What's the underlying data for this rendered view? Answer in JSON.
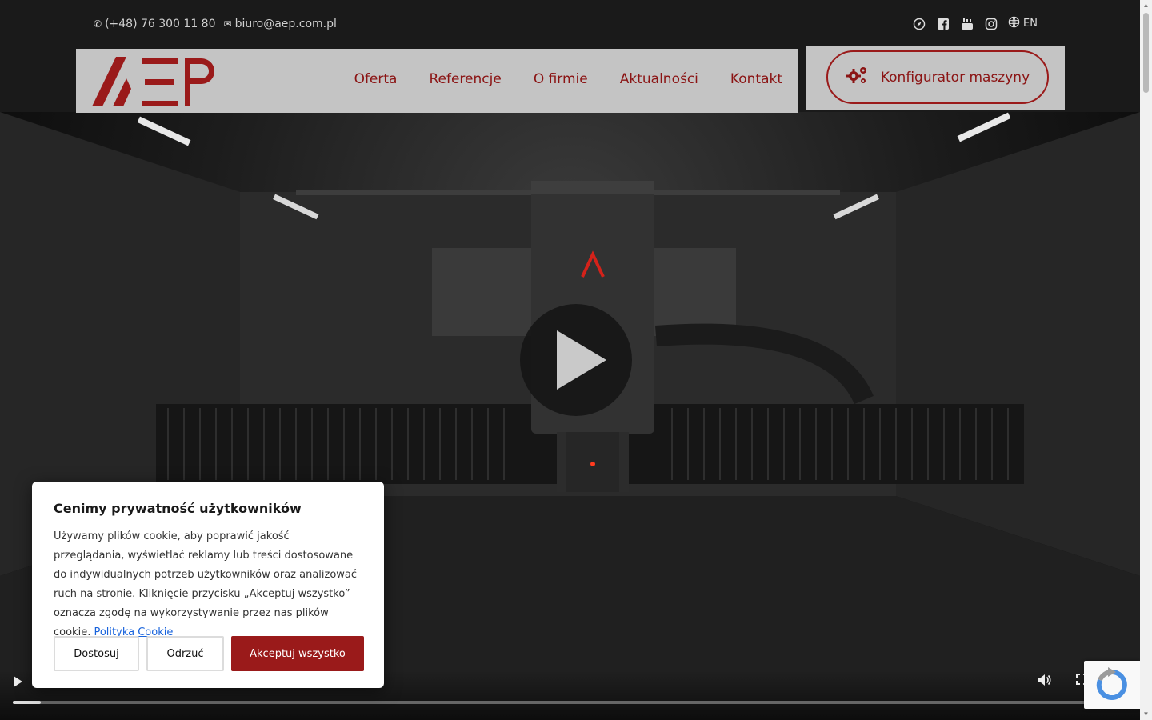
{
  "topbar": {
    "phone": "(+48) 76 300 11 80",
    "email": "biuro@aep.com.pl",
    "language": "EN"
  },
  "header": {
    "logo_text": "AEP",
    "nav": [
      {
        "label": "Oferta"
      },
      {
        "label": "Referencje"
      },
      {
        "label": "O firmie"
      },
      {
        "label": "Aktualności"
      },
      {
        "label": "Kontakt"
      }
    ],
    "configurator_label": "Konfigurator maszyny"
  },
  "video": {
    "progress_fraction": 0.025
  },
  "cookie": {
    "title": "Cenimy prywatność użytkowników",
    "body": "Używamy plików cookie, aby poprawić jakość przeglądania, wyświetlać reklamy lub treści dostosowane do indywidualnych potrzeb użytkowników oraz analizować ruch na stronie. Kliknięcie przycisku „Akceptuj wszystko” oznacza zgodę na wykorzystywanie przez nas plików cookie.",
    "policy_link": "Polityka Cookie",
    "buttons": {
      "customize": "Dostosuj",
      "reject": "Odrzuć",
      "accept": "Akceptuj wszystko"
    }
  },
  "colors": {
    "brand": "#9a1a1a",
    "header_bg": "#c4c4c4",
    "link": "#1863dc"
  },
  "icons": [
    "phone-icon",
    "envelope-icon",
    "compass-icon",
    "facebook-icon",
    "youtube-icon",
    "instagram-icon",
    "globe-icon",
    "gears-icon",
    "play-icon",
    "volume-icon",
    "fullscreen-icon",
    "recaptcha-icon"
  ]
}
